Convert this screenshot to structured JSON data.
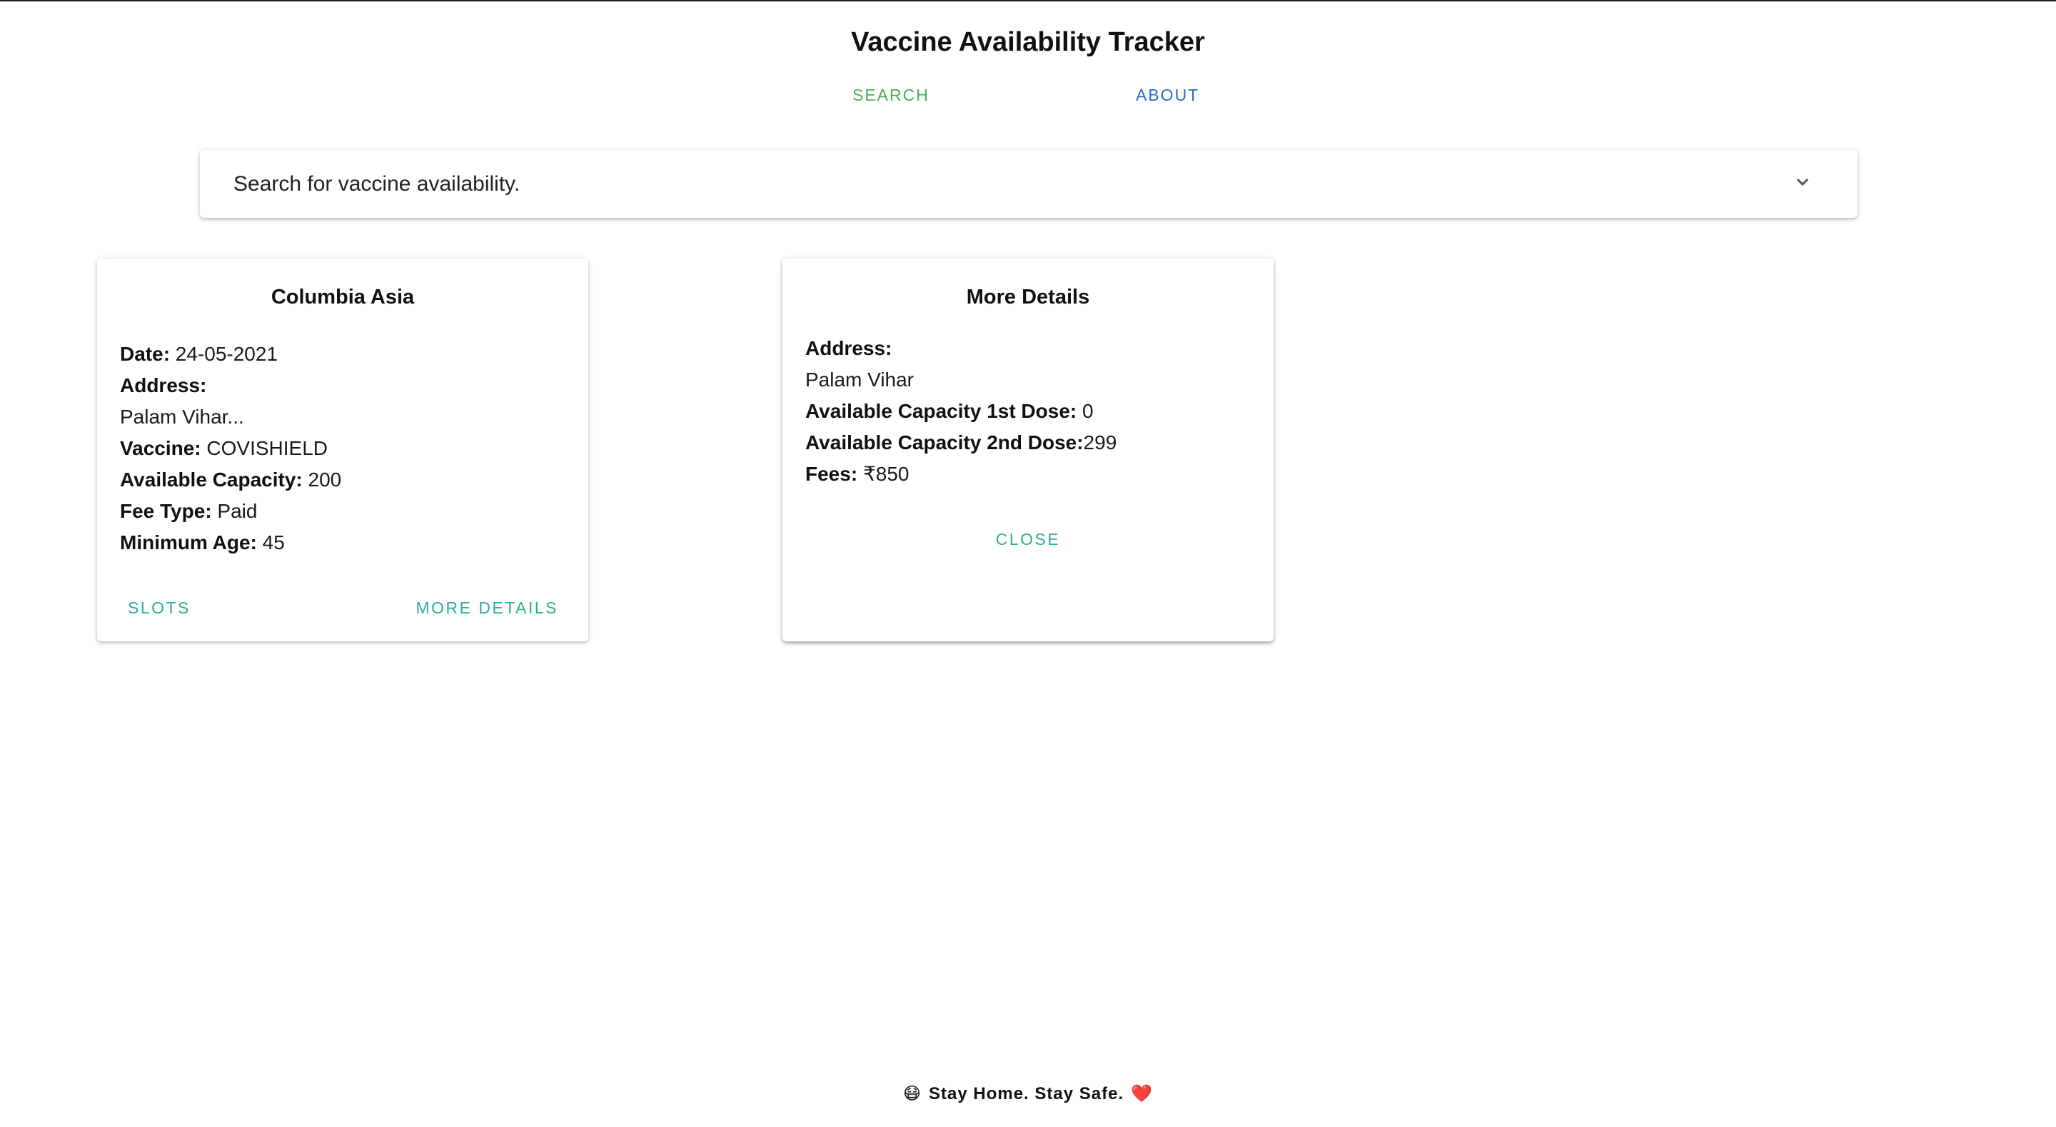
{
  "app": {
    "title": "Vaccine Availability Tracker"
  },
  "nav": {
    "search_label": "SEARCH",
    "about_label": "ABOUT",
    "search_color": "#4caf50",
    "about_color": "#1e6fd0"
  },
  "search_panel": {
    "label": "Search for vaccine availability.",
    "expand_icon": "chevron-down-icon"
  },
  "center_card": {
    "title": "Columbia Asia",
    "date_label": "Date:",
    "date_value": "24-05-2021",
    "address_label": "Address:",
    "address_value": "Palam Vihar...",
    "vaccine_label": "Vaccine:",
    "vaccine_value": "COVISHIELD",
    "capacity_label": "Available Capacity:",
    "capacity_value": "200",
    "fee_type_label": "Fee Type:",
    "fee_type_value": "Paid",
    "min_age_label": "Minimum Age:",
    "min_age_value": "45",
    "slots_button": "SLOTS",
    "more_details_button": "MORE DETAILS"
  },
  "details_card": {
    "title": "More Details",
    "address_label": "Address:",
    "address_value": "Palam Vihar",
    "dose1_label": "Available Capacity 1st Dose:",
    "dose1_value": "0",
    "dose2_label": "Available Capacity 2nd Dose:",
    "dose2_value": "299",
    "fees_label": "Fees:",
    "fees_value": "₹850",
    "close_button": "CLOSE"
  },
  "footer": {
    "left_emoji": "😷",
    "text": "Stay Home. Stay Safe.",
    "right_emoji": "❤️"
  },
  "colors": {
    "accent_teal": "#2bb08f"
  }
}
